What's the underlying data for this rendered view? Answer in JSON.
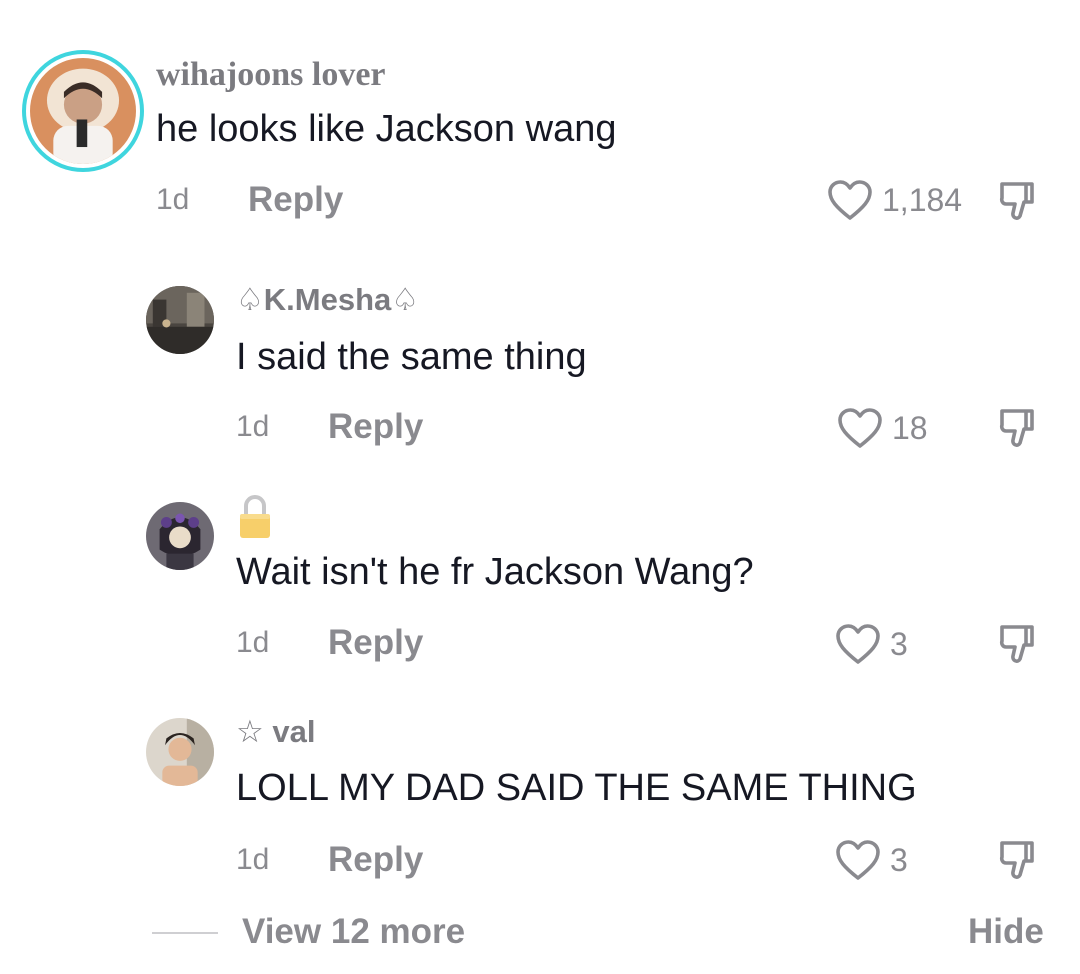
{
  "comments": [
    {
      "username": "wihajoons lover",
      "text": "he looks like Jackson wang",
      "time": "1d",
      "reply_label": "Reply",
      "likes": "1,184"
    },
    {
      "username": "♤K.Mesha♤",
      "text": "I said the same thing",
      "time": "1d",
      "reply_label": "Reply",
      "likes": "18"
    },
    {
      "username": "",
      "text": "Wait isn't he fr Jackson Wang?",
      "time": "1d",
      "reply_label": "Reply",
      "likes": "3"
    },
    {
      "username": "☆ val",
      "text": "LOLL MY DAD SAID THE SAME THING",
      "time": "1d",
      "reply_label": "Reply",
      "likes": "3"
    }
  ],
  "footer": {
    "view_more_label": "View 12 more",
    "hide_label": "Hide"
  },
  "colors": {
    "accent_ring": "#3fd5de",
    "muted": "#8a8a8f",
    "text": "#161823"
  }
}
